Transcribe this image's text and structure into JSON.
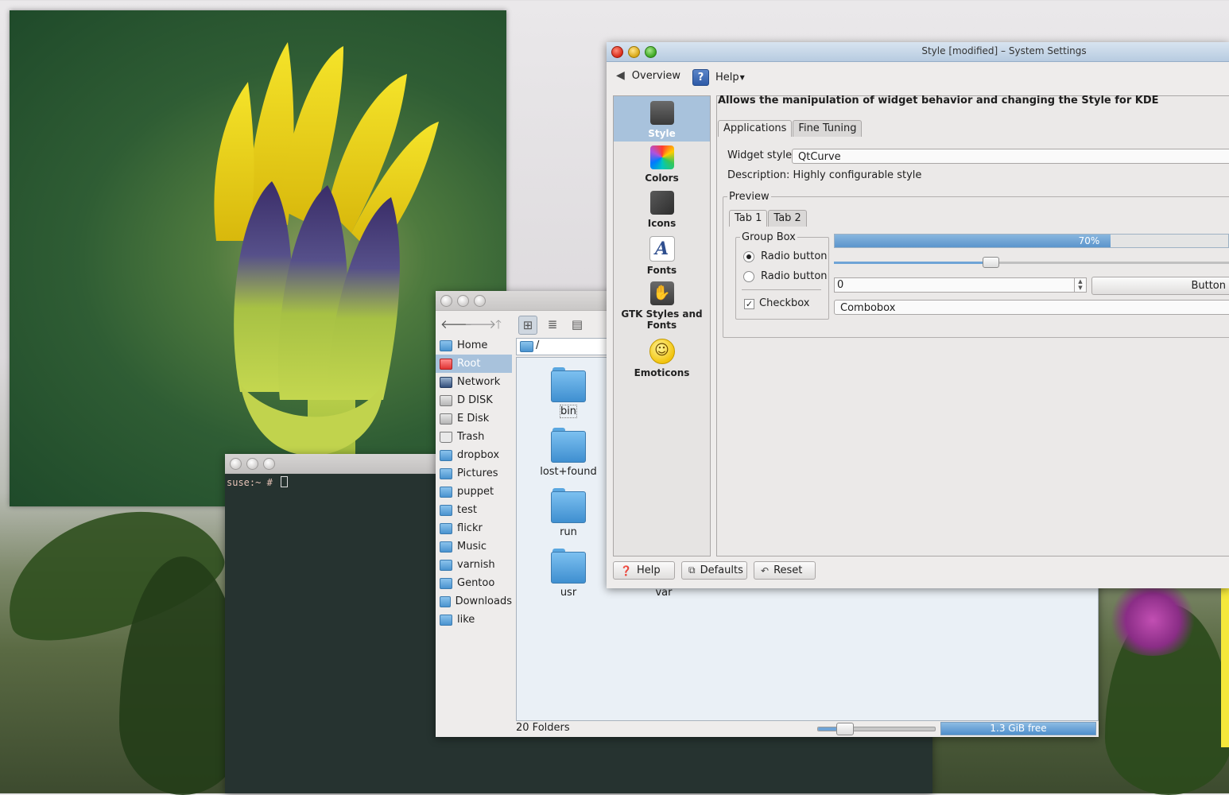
{
  "terminal": {
    "prompt": "suse:~ # "
  },
  "file_manager": {
    "places": [
      "Home",
      "Root",
      "Network",
      "D DISK",
      "E Disk",
      "Trash",
      "dropbox",
      "Pictures",
      "puppet",
      "test",
      "flickr",
      "Music",
      "varnish",
      "Gentoo",
      "Downloads",
      "like"
    ],
    "selected_place": "Root",
    "path": "/",
    "folders": [
      "bin",
      "lost+found",
      "run",
      "usr",
      "var"
    ],
    "status": "20 Folders",
    "free_space": "1.3 GiB free"
  },
  "settings": {
    "title": "Style [modified] – System Settings",
    "toolbar": {
      "overview": "Overview",
      "help": "Help"
    },
    "modules": [
      "Style",
      "Colors",
      "Icons",
      "Fonts",
      "GTK Styles and Fonts",
      "Emoticons"
    ],
    "heading": "Allows the manipulation of widget behavior and changing the Style for KDE",
    "tabs": [
      "Applications",
      "Fine Tuning"
    ],
    "widget_style_label": "Widget style:",
    "widget_style_value": "QtCurve",
    "description": "Description: Highly configurable style",
    "preview_label": "Preview",
    "preview_tabs": [
      "Tab 1",
      "Tab 2"
    ],
    "group_box_label": "Group Box",
    "radio1": "Radio button",
    "radio2": "Radio button",
    "checkbox": "Checkbox",
    "progress_text": "70%",
    "progress_value": 70,
    "spin_value": "0",
    "push_button": "Button",
    "combobox": "Combobox",
    "buttons": {
      "help": "Help",
      "defaults": "Defaults",
      "reset": "Reset"
    }
  }
}
